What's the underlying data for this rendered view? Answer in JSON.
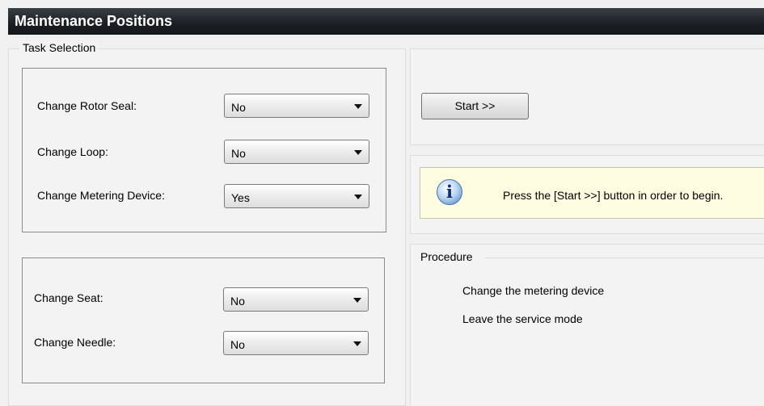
{
  "window": {
    "title": "Maintenance Positions"
  },
  "task_selection": {
    "label": "Task Selection",
    "group1": [
      {
        "label": "Change Rotor Seal:",
        "value": "No"
      },
      {
        "label": "Change Loop:",
        "value": "No"
      },
      {
        "label": "Change Metering Device:",
        "value": "Yes"
      }
    ],
    "group2": [
      {
        "label": "Change Seat:",
        "value": "No"
      },
      {
        "label": "Change Needle:",
        "value": "No"
      }
    ]
  },
  "start_button": {
    "label": "Start >>"
  },
  "info": {
    "icon": "info-icon",
    "text": "Press the [Start >>] button in order to begin."
  },
  "procedure": {
    "label": "Procedure",
    "steps": [
      "Change the metering device",
      "Leave the service mode"
    ]
  }
}
